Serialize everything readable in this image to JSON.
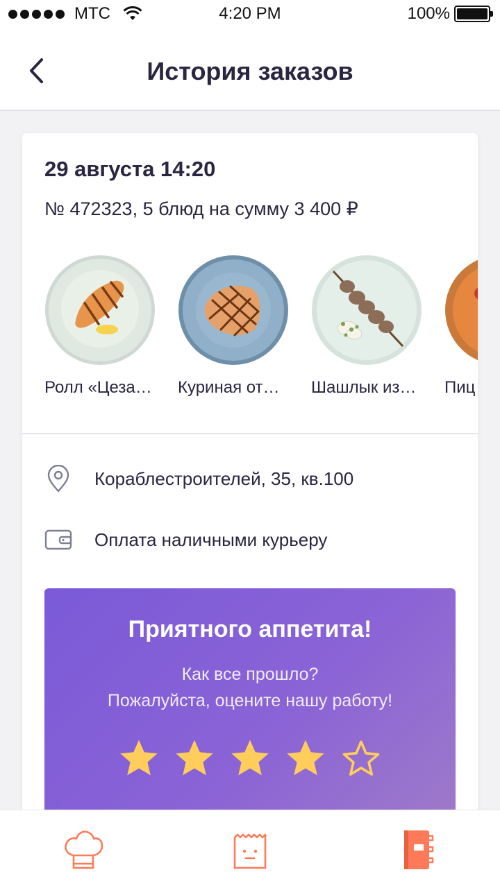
{
  "status_bar": {
    "carrier": "МТС",
    "time": "4:20 PM",
    "battery": "100%"
  },
  "header": {
    "title": "История заказов"
  },
  "order": {
    "date": "29 августа 14:20",
    "summary": "№ 472323, 5 блюд на сумму 3 400 ₽",
    "dishes": [
      {
        "name": "Ролл «Цеза…",
        "image": "grilled-salmon-plate"
      },
      {
        "name": "Куриная от…",
        "image": "grilled-chicken-plate"
      },
      {
        "name": "Шашлык из…",
        "image": "kebab-skewer-plate"
      },
      {
        "name": "Пиц",
        "image": "pizza"
      }
    ],
    "address": "Кораблестроителей, 35, кв.100",
    "payment": "Оплата наличными курьеру"
  },
  "rating": {
    "title": "Приятного аппетита!",
    "question_line1": "Как все прошло?",
    "question_line2": "Пожалуйста, оцените нашу работу!",
    "stars_total": 5,
    "stars_filled": 4
  },
  "tab_bar": {
    "items": [
      {
        "icon": "chef-hat-icon"
      },
      {
        "icon": "bag-icon"
      },
      {
        "icon": "notebook-icon",
        "active": true
      }
    ]
  },
  "colors": {
    "accent": "#ff7a59",
    "banner_start": "#7b5ad8",
    "banner_end": "#a07bc8",
    "star": "#ffcd5c",
    "text": "#2a2540"
  }
}
